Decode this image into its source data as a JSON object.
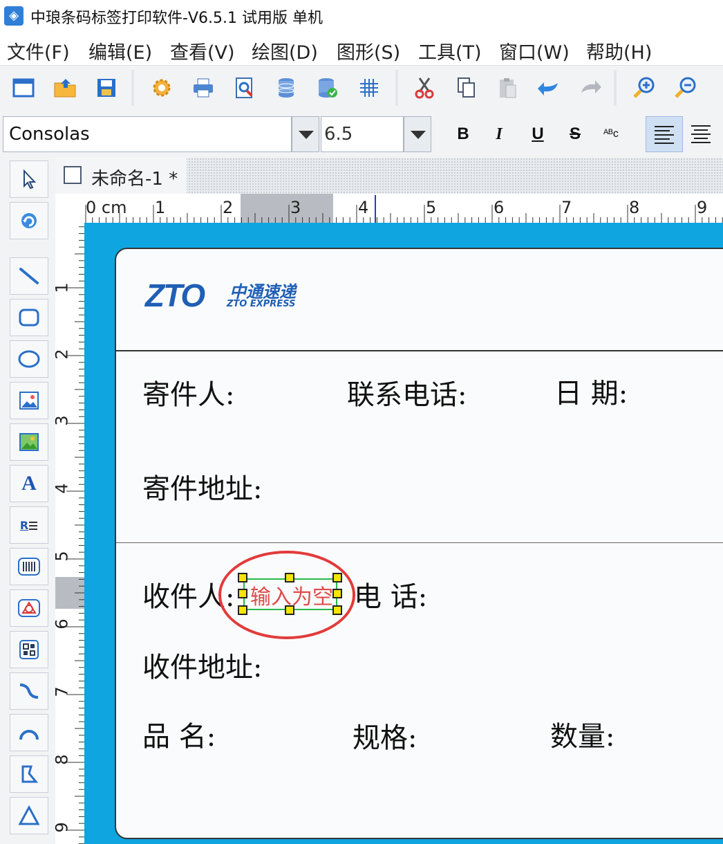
{
  "window": {
    "title": "中琅条码标签打印软件-V6.5.1 试用版 单机"
  },
  "menu": [
    {
      "label": "文件(F)"
    },
    {
      "label": "编辑(E)"
    },
    {
      "label": "查看(V)"
    },
    {
      "label": "绘图(D)"
    },
    {
      "label": "图形(S)"
    },
    {
      "label": "工具(T)"
    },
    {
      "label": "窗口(W)"
    },
    {
      "label": "帮助(H)"
    }
  ],
  "toolbar": {
    "buttons": [
      "new-icon",
      "open-icon",
      "save-icon",
      "settings-icon",
      "print-icon",
      "print-preview-icon",
      "database-icon",
      "database-check-icon",
      "grid-icon",
      "cut-icon",
      "copy-icon",
      "paste-icon",
      "undo-icon",
      "redo-icon",
      "zoom-in-icon",
      "zoom-out-icon"
    ]
  },
  "font_bar": {
    "font": "Consolas",
    "size": "6.5",
    "bold": "B",
    "italic": "I",
    "underline": "U",
    "strike": "S",
    "case": "ᴬᴮc"
  },
  "palette": {
    "tools": [
      "select-icon",
      "rotate-icon",
      "line-icon",
      "rounded-rect-icon",
      "ellipse-icon",
      "image-icon",
      "picture-icon",
      "text-icon",
      "rich-text-icon",
      "barcode-icon",
      "shape-icon",
      "qrcode-icon",
      "curve-icon",
      "arc-icon",
      "polygon-icon",
      "triangle-icon"
    ],
    "text_tool_label": "A",
    "rich_text_label": "R"
  },
  "document": {
    "tab_label": "未命名-1 *"
  },
  "ruler": {
    "h_labels": [
      "0 cm",
      "1",
      "2",
      "3",
      "4",
      "5",
      "6",
      "7",
      "8",
      "9"
    ],
    "v_labels": [
      "1",
      "2",
      "3",
      "4",
      "5",
      "6",
      "7",
      "8",
      "9"
    ]
  },
  "label": {
    "logo_text": "ZTO",
    "logo_cn": "中通速递",
    "logo_en": "ZTO EXPRESS",
    "sender": "寄件人:",
    "phone": "联系电话:",
    "date": "日 期:",
    "sender_address": "寄件地址:",
    "recipient": "收件人:",
    "recipient_phone": "电 话:",
    "recipient_address": "收件地址:",
    "product": "品 名:",
    "spec": "规格:",
    "quantity": "数量:",
    "selected_placeholder": "输入为空"
  },
  "colors": {
    "canvas": "#0ea5e0",
    "highlight": "#e23b3b",
    "selection": "#27b84a",
    "handle": "#f5e50a"
  }
}
